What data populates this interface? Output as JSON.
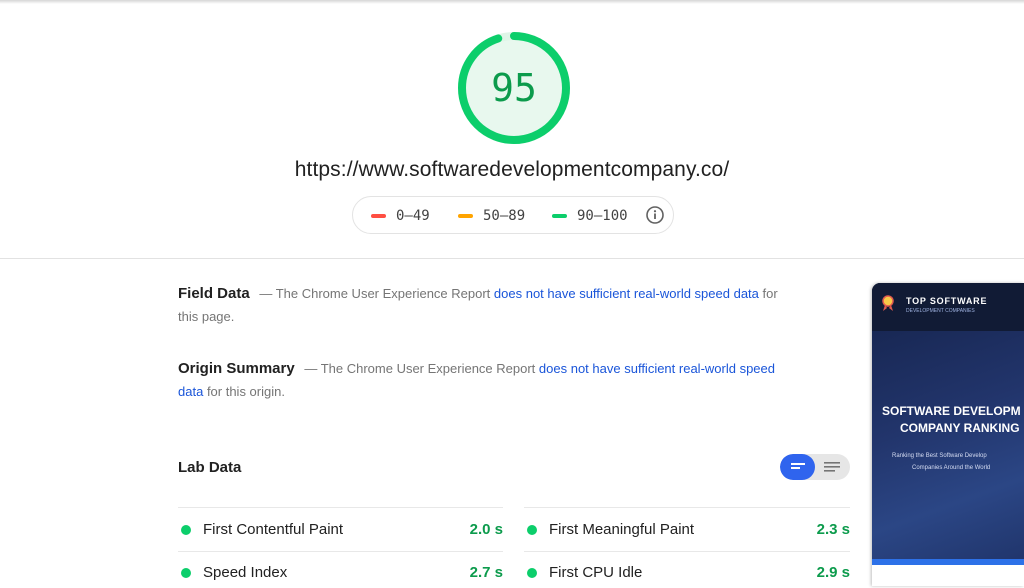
{
  "report": {
    "score": "95",
    "score_fraction": 0.95,
    "url": "https://www.softwaredevelopmentcompany.co/"
  },
  "legend": [
    {
      "label": "0–49",
      "color": "#ff4e42"
    },
    {
      "label": "50–89",
      "color": "#ffa400"
    },
    {
      "label": "90–100",
      "color": "#0cce6b"
    }
  ],
  "field_data": {
    "title": "Field Data",
    "prefix": "— The Chrome User Experience Report",
    "link": "does not have sufficient real-world speed data",
    "suffix": "for this page."
  },
  "origin_summary": {
    "title": "Origin Summary",
    "prefix": "— The Chrome User Experience Report",
    "link": "does not have sufficient real-world speed data",
    "suffix": "for this origin."
  },
  "lab_data": {
    "title": "Lab Data",
    "metrics": [
      {
        "label": "First Contentful Paint",
        "value": "2.0 s"
      },
      {
        "label": "First Meaningful Paint",
        "value": "2.3 s"
      },
      {
        "label": "Speed Index",
        "value": "2.7 s"
      },
      {
        "label": "First CPU Idle",
        "value": "2.9 s"
      }
    ]
  },
  "screenshot": {
    "brand": "TOP SOFTWARE",
    "brand_sub": "DEVELOPMENT COMPANIES",
    "heading_line1": "SOFTWARE DEVELOPM",
    "heading_line2": "COMPANY RANKING",
    "sub_line1": "Ranking the Best Software Develop",
    "sub_line2": "Companies Around the World"
  },
  "colors": {
    "pass": "#0cce6b",
    "pass_text": "#0c9b4c",
    "link": "#1a55d9",
    "toggle_active": "#2f64ee"
  },
  "icons": {
    "legend_info": "info-icon",
    "toggle_left": "bar-chart-icon",
    "toggle_right": "list-icon"
  }
}
